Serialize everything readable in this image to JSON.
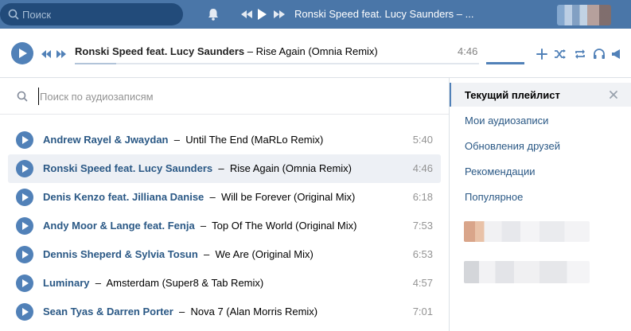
{
  "topbar": {
    "search_placeholder": "Поиск",
    "now_playing": "Ronski Speed feat. Lucy Saunders – ..."
  },
  "player": {
    "artist": "Ronski Speed feat. Lucy Saunders",
    "separator": " – ",
    "title": "Rise Again (Omnia Remix)",
    "duration": "4:46"
  },
  "main": {
    "search_placeholder": "Поиск по аудиозаписям",
    "tracks": [
      {
        "artist": "Andrew Rayel & Jwaydan",
        "title": "Until The End (MaRLo Remix)",
        "duration": "5:40"
      },
      {
        "artist": "Ronski Speed feat. Lucy Saunders",
        "title": "Rise Again (Omnia Remix)",
        "duration": "4:46"
      },
      {
        "artist": "Denis Kenzo feat. Jilliana Danise",
        "title": "Will be Forever (Original Mix)",
        "duration": "6:18"
      },
      {
        "artist": "Andy Moor & Lange feat. Fenja",
        "title": "Top Of The World (Original Mix)",
        "duration": "7:53"
      },
      {
        "artist": "Dennis Sheperd & Sylvia Tosun",
        "title": "We Are (Original Mix)",
        "duration": "6:53"
      },
      {
        "artist": "Luminary",
        "title": "Amsterdam (Super8 & Tab Remix)",
        "duration": "4:57"
      },
      {
        "artist": "Sean Tyas & Darren Porter",
        "title": "Nova 7 (Alan Morris Remix)",
        "duration": "7:01"
      }
    ],
    "separator": "–"
  },
  "side": {
    "current_label": "Текущий плейлист",
    "items": [
      "Мои аудиозаписи",
      "Обновления друзей",
      "Рекомендации",
      "Популярное"
    ]
  },
  "colors": {
    "header": "#4a76a8",
    "accent": "#5181b8",
    "link": "#2a5885",
    "active_row": "#edf0f5"
  }
}
